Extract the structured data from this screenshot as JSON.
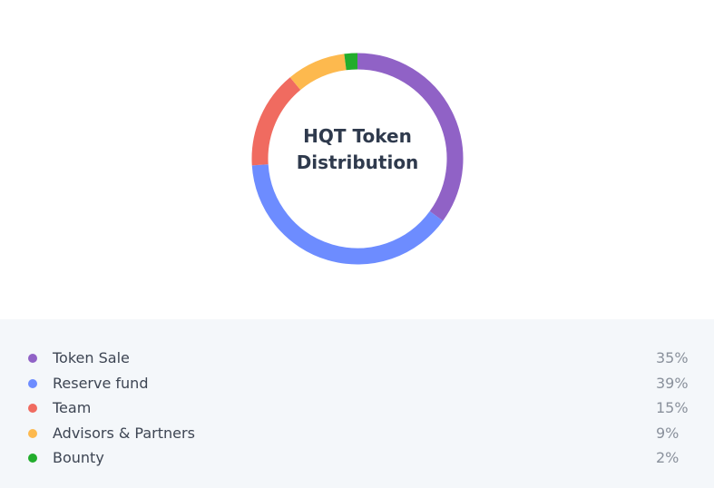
{
  "chart_data": {
    "type": "pie",
    "title_lines": [
      "HQT Token",
      "Distribution"
    ],
    "categories": [
      "Token Sale",
      "Reserve fund",
      "Team",
      "Advisors & Partners",
      "Bounty"
    ],
    "values": [
      35,
      39,
      15,
      9,
      2
    ],
    "value_labels": [
      "35%",
      "39%",
      "15%",
      "9%",
      "2%"
    ],
    "colors": [
      "#9062c6",
      "#6d8cff",
      "#f06b60",
      "#fdb94e",
      "#22ad2c"
    ],
    "style": "donut",
    "legend": "bottom"
  },
  "legend_dot_color_map": "chart_data.colors"
}
